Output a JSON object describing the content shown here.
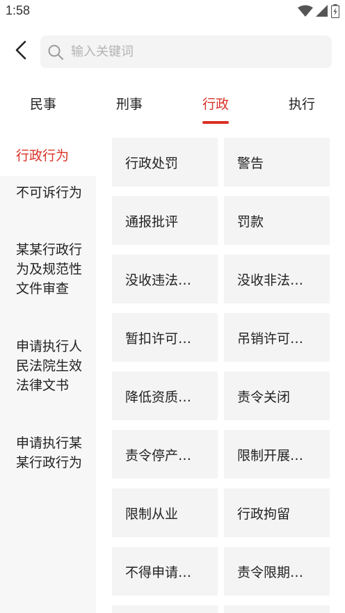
{
  "status": {
    "time": "1:58"
  },
  "search": {
    "placeholder": "输入关键词"
  },
  "tabs": [
    {
      "label": "民事"
    },
    {
      "label": "刑事"
    },
    {
      "label": "行政"
    },
    {
      "label": "执行"
    }
  ],
  "active_tab": "行政",
  "accent_color": "#d93025",
  "left_nav": [
    {
      "label": "行政行为"
    },
    {
      "label": "不可诉行为"
    },
    {
      "label": "某某行政行为及规范性文件审查"
    },
    {
      "label": "申请执行人民法院生效法律文书"
    },
    {
      "label": "申请执行某某行政行为"
    }
  ],
  "grid_items": [
    {
      "label": "行政处罚"
    },
    {
      "label": "警告"
    },
    {
      "label": "通报批评"
    },
    {
      "label": "罚款"
    },
    {
      "label": "没收违法…"
    },
    {
      "label": "没收非法…"
    },
    {
      "label": "暂扣许可…"
    },
    {
      "label": "吊销许可…"
    },
    {
      "label": "降低资质…"
    },
    {
      "label": "责令关闭"
    },
    {
      "label": "责令停产…"
    },
    {
      "label": "限制开展…"
    },
    {
      "label": "限制从业"
    },
    {
      "label": "行政拘留"
    },
    {
      "label": "不得申请…"
    },
    {
      "label": "责令限期…"
    }
  ]
}
